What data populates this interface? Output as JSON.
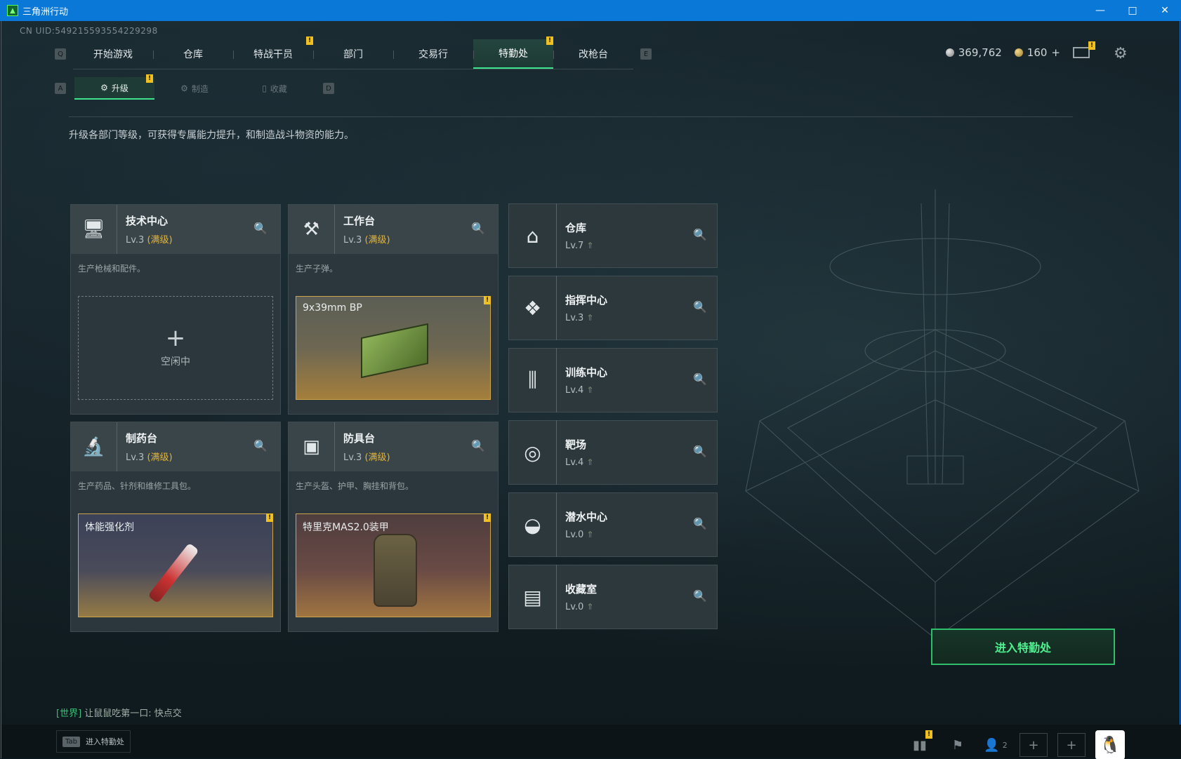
{
  "window": {
    "title": "三角洲行动",
    "minimize": "—",
    "maximize": "□",
    "close": "✕"
  },
  "uid": "CN UID:549215593554229298",
  "top_nav": {
    "left_key": "Q",
    "right_key": "E",
    "tabs": [
      {
        "label": "开始游戏",
        "active": false,
        "badge": ""
      },
      {
        "label": "仓库",
        "active": false,
        "badge": ""
      },
      {
        "label": "特战干员",
        "active": false,
        "badge": "!"
      },
      {
        "label": "部门",
        "active": false,
        "badge": ""
      },
      {
        "label": "交易行",
        "active": false,
        "badge": ""
      },
      {
        "label": "特勤处",
        "active": true,
        "badge": "!"
      },
      {
        "label": "改枪台",
        "active": false,
        "badge": ""
      }
    ]
  },
  "sub_nav": {
    "left_key": "A",
    "right_key": "D",
    "tabs": [
      {
        "label": "升级",
        "active": true,
        "badge": "!"
      },
      {
        "label": "制造",
        "active": false,
        "badge": ""
      },
      {
        "label": "收藏",
        "active": false,
        "badge": ""
      }
    ]
  },
  "currency": {
    "silver": "369,762",
    "gold": "160",
    "gold_add": "+"
  },
  "description": "升级各部门等级，可获得专属能力提升，和制造战斗物资的能力。",
  "workshops": [
    {
      "name": "技术中心",
      "level": "Lv.3",
      "max": "(满级)",
      "desc": "生产枪械和配件。",
      "slot_type": "empty",
      "slot_label": "空闲中",
      "icon": "monitor-icon"
    },
    {
      "name": "工作台",
      "level": "Lv.3",
      "max": "(满级)",
      "desc": "生产子弹。",
      "slot_type": "ammo",
      "slot_label": "9x39mm BP",
      "icon": "tools-icon"
    },
    {
      "name": "制药台",
      "level": "Lv.3",
      "max": "(满级)",
      "desc": "生产药品、针剂和维修工具包。",
      "slot_type": "med",
      "slot_label": "体能强化剂",
      "icon": "microscope-icon"
    },
    {
      "name": "防具台",
      "level": "Lv.3",
      "max": "(满级)",
      "desc": "生产头盔、护甲、胸挂和背包。",
      "slot_type": "armor",
      "slot_label": "特里克MAS2.0装甲",
      "icon": "cubes-icon"
    }
  ],
  "facilities": [
    {
      "name": "仓库",
      "level": "Lv.7",
      "icon": "warehouse-icon"
    },
    {
      "name": "指挥中心",
      "level": "Lv.3",
      "icon": "command-icon"
    },
    {
      "name": "训练中心",
      "level": "Lv.4",
      "icon": "dumbbell-icon"
    },
    {
      "name": "靶场",
      "level": "Lv.4",
      "icon": "target-icon"
    },
    {
      "name": "潜水中心",
      "level": "Lv.0",
      "icon": "diving-mask-icon"
    },
    {
      "name": "收藏室",
      "level": "Lv.0",
      "icon": "collection-icon"
    }
  ],
  "enter_button": "进入特勤处",
  "chat": {
    "channel": "[世界]",
    "message": "让鼠鼠吃第一口: 快点交"
  },
  "bottom": {
    "tab_key": "Tab",
    "tab_label": "进入特勤处",
    "friends_count": "2"
  },
  "colors": {
    "accent_green": "#3ee48c",
    "badge_yellow": "#f0c020",
    "max_level": "#e2b43a",
    "title_bar": "#0a78d7"
  }
}
